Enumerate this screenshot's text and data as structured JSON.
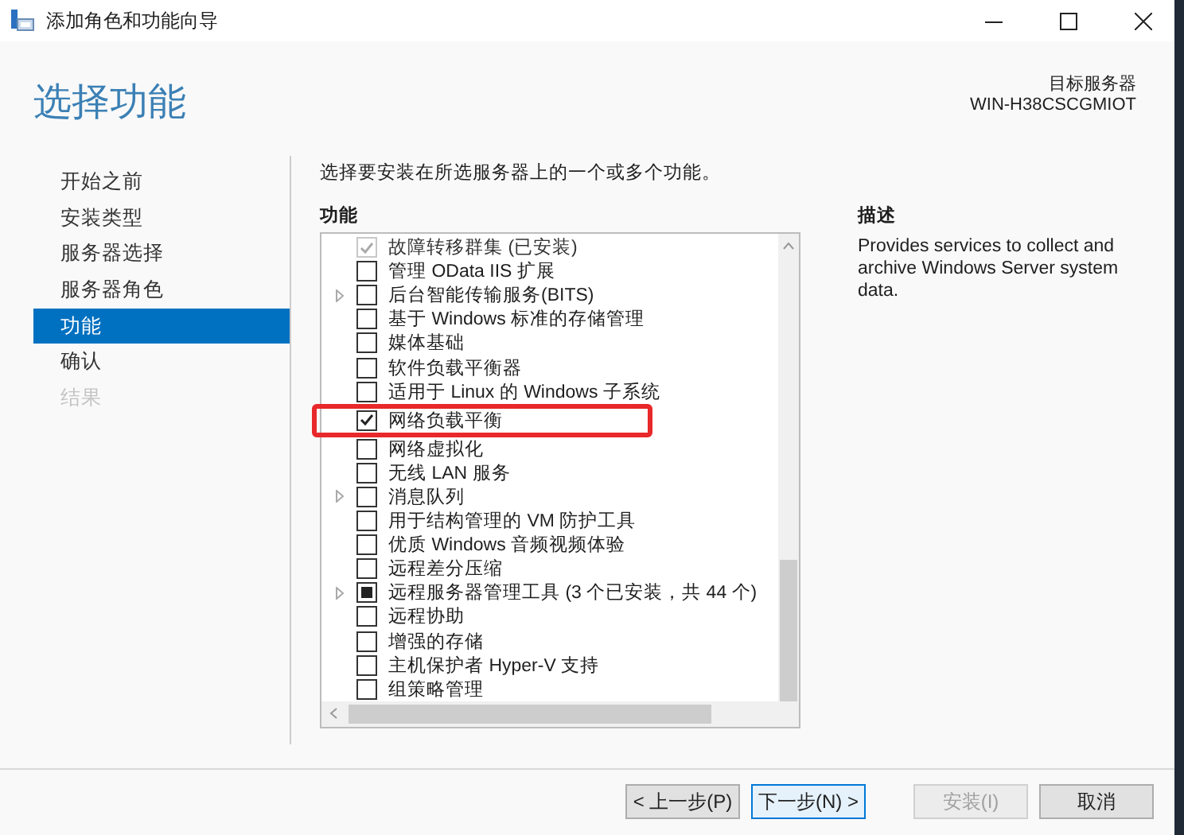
{
  "window": {
    "title": "添加角色和功能向导"
  },
  "header": {
    "title": "选择功能",
    "target_label": "目标服务器",
    "target_server": "WIN-H38CSCGMIOT"
  },
  "nav": [
    {
      "label": "开始之前",
      "selected": false,
      "disabled": false
    },
    {
      "label": "安装类型",
      "selected": false,
      "disabled": false
    },
    {
      "label": "服务器选择",
      "selected": false,
      "disabled": false
    },
    {
      "label": "服务器角色",
      "selected": false,
      "disabled": false
    },
    {
      "label": "功能",
      "selected": true,
      "disabled": false
    },
    {
      "label": "确认",
      "selected": false,
      "disabled": false
    },
    {
      "label": "结果",
      "selected": false,
      "disabled": true
    }
  ],
  "intro": "选择要安装在所选服务器上的一个或多个功能。",
  "features_heading": "功能",
  "features": [
    {
      "label": "故障转移群集 (已安装)",
      "checked": true,
      "indeterminate": false,
      "disabled": true,
      "expandable": false,
      "highlighted": false
    },
    {
      "label": "管理 OData IIS 扩展",
      "checked": false,
      "indeterminate": false,
      "disabled": false,
      "expandable": false,
      "highlighted": false
    },
    {
      "label": "后台智能传输服务(BITS)",
      "checked": false,
      "indeterminate": false,
      "disabled": false,
      "expandable": true,
      "highlighted": false
    },
    {
      "label": "基于 Windows 标准的存储管理",
      "checked": false,
      "indeterminate": false,
      "disabled": false,
      "expandable": false,
      "highlighted": false
    },
    {
      "label": "媒体基础",
      "checked": false,
      "indeterminate": false,
      "disabled": false,
      "expandable": false,
      "highlighted": false
    },
    {
      "label": "软件负载平衡器",
      "checked": false,
      "indeterminate": false,
      "disabled": false,
      "expandable": false,
      "highlighted": false
    },
    {
      "label": "适用于 Linux 的 Windows 子系统",
      "checked": false,
      "indeterminate": false,
      "disabled": false,
      "expandable": false,
      "highlighted": false
    },
    {
      "label": "网络负载平衡",
      "checked": true,
      "indeterminate": false,
      "disabled": false,
      "expandable": false,
      "highlighted": true
    },
    {
      "label": "网络虚拟化",
      "checked": false,
      "indeterminate": false,
      "disabled": false,
      "expandable": false,
      "highlighted": false
    },
    {
      "label": "无线 LAN 服务",
      "checked": false,
      "indeterminate": false,
      "disabled": false,
      "expandable": false,
      "highlighted": false
    },
    {
      "label": "消息队列",
      "checked": false,
      "indeterminate": false,
      "disabled": false,
      "expandable": true,
      "highlighted": false
    },
    {
      "label": "用于结构管理的 VM 防护工具",
      "checked": false,
      "indeterminate": false,
      "disabled": false,
      "expandable": false,
      "highlighted": false
    },
    {
      "label": "优质 Windows 音频视频体验",
      "checked": false,
      "indeterminate": false,
      "disabled": false,
      "expandable": false,
      "highlighted": false
    },
    {
      "label": "远程差分压缩",
      "checked": false,
      "indeterminate": false,
      "disabled": false,
      "expandable": false,
      "highlighted": false
    },
    {
      "label": "远程服务器管理工具 (3 个已安装，共 44 个)",
      "checked": false,
      "indeterminate": true,
      "disabled": false,
      "expandable": true,
      "highlighted": false
    },
    {
      "label": "远程协助",
      "checked": false,
      "indeterminate": false,
      "disabled": false,
      "expandable": false,
      "highlighted": false
    },
    {
      "label": "增强的存储",
      "checked": false,
      "indeterminate": false,
      "disabled": false,
      "expandable": false,
      "highlighted": false
    },
    {
      "label": "主机保护者 Hyper-V 支持",
      "checked": false,
      "indeterminate": false,
      "disabled": false,
      "expandable": false,
      "highlighted": false
    },
    {
      "label": "组策略管理",
      "checked": false,
      "indeterminate": false,
      "disabled": false,
      "expandable": false,
      "highlighted": false
    }
  ],
  "description": {
    "heading": "描述",
    "text": "Provides services to collect and archive Windows Server system data."
  },
  "buttons": [
    {
      "label": "< 上一步(P)",
      "disabled": false,
      "focused": false
    },
    {
      "label": "下一步(N) >",
      "disabled": false,
      "focused": true
    },
    {
      "label": "安装(I)",
      "disabled": true,
      "focused": false
    },
    {
      "label": "取消",
      "disabled": false,
      "focused": false
    }
  ]
}
